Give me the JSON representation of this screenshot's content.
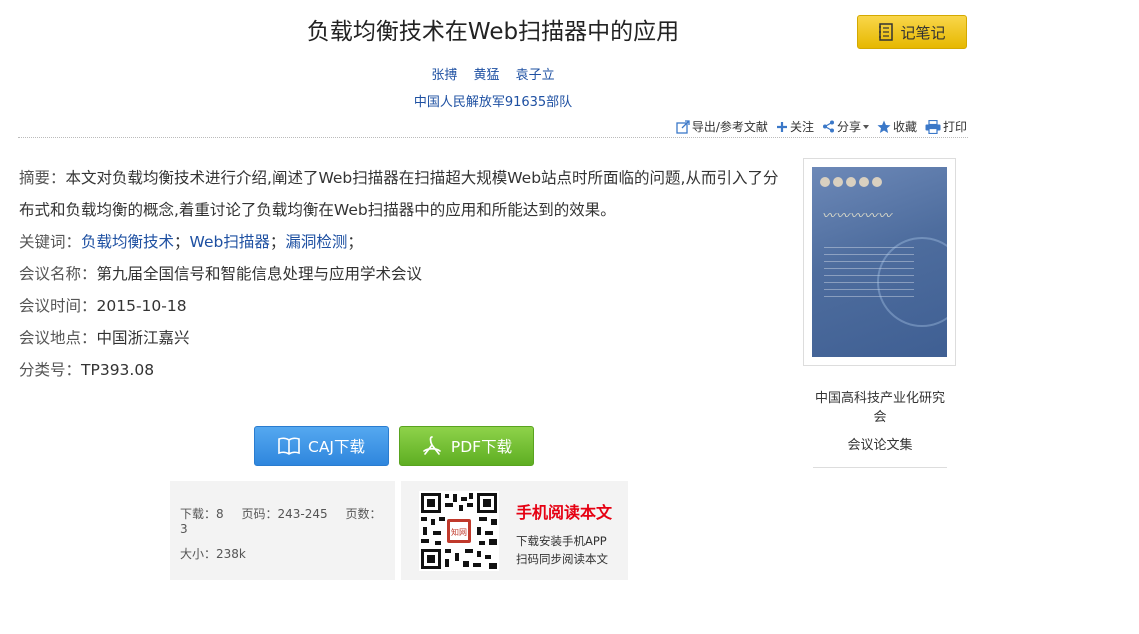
{
  "article": {
    "title": "负载均衡技术在Web扫描器中的应用",
    "authors": [
      "张搏",
      "黄猛",
      "袁子立"
    ],
    "organization": "中国人民解放军91635部队"
  },
  "note_button": {
    "label": "记笔记"
  },
  "tools": {
    "export": "导出/参考文献",
    "follow": "关注",
    "share": "分享",
    "favorite": "收藏",
    "print": "打印"
  },
  "meta": {
    "abstract_label": "摘要：",
    "abstract": "本文对负载均衡技术进行介绍,阐述了Web扫描器在扫描超大规模Web站点时所面临的问题,从而引入了分布式和负载均衡的概念,着重讨论了负载均衡在Web扫描器中的应用和所能达到的效果。",
    "keywords_label": "关键词：",
    "keywords": [
      "负载均衡技术",
      "Web扫描器",
      "漏洞检测"
    ],
    "keyword_sep": "；",
    "conference_label": "会议名称：",
    "conference": "第九届全国信号和智能信息处理与应用学术会议",
    "date_label": "会议时间：",
    "date": "2015-10-18",
    "location_label": "会议地点：",
    "location": "中国浙江嘉兴",
    "class_label": "分类号：",
    "class": "TP393.08"
  },
  "publication": {
    "publisher": "中国高科技产业化研究会",
    "type": "会议论文集"
  },
  "downloads": {
    "caj": "CAJ下载",
    "pdf": "PDF下载"
  },
  "stats": {
    "downloads": "下载：8",
    "pages": "页码：243-245",
    "page_count": "页数：3",
    "size": "大小：238k"
  },
  "mobile": {
    "title": "手机阅读本文",
    "line1": "下载安装手机APP",
    "line2": "扫码同步阅读本文"
  },
  "colors": {
    "link": "#1e50a2",
    "note_btn": "#f2c400",
    "caj_btn": "#3d93e6",
    "pdf_btn": "#6cbf2c",
    "mobile_title": "#e60012"
  }
}
